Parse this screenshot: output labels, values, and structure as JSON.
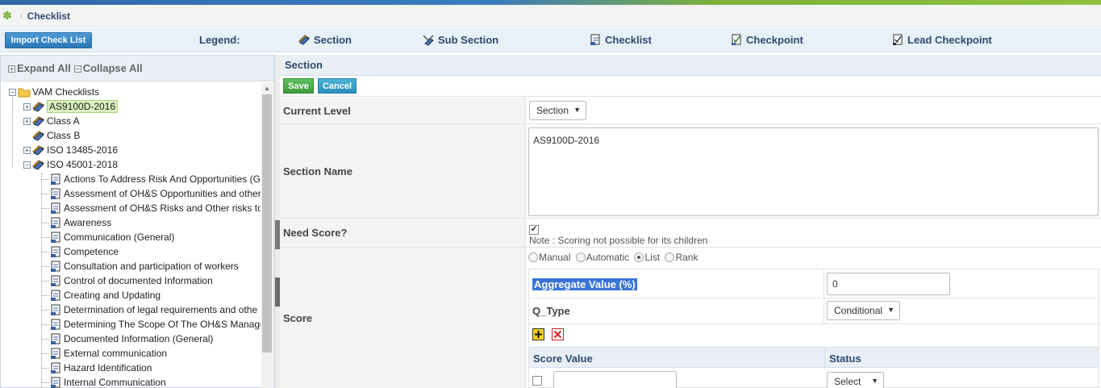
{
  "breadcrumb": {
    "title": "Checklist"
  },
  "toolbar": {
    "import_label": "Import Check List",
    "legend_label": "Legend:",
    "legend": [
      {
        "label": "Section",
        "icon": "section-icon"
      },
      {
        "label": "Sub Section",
        "icon": "sub-section-icon"
      },
      {
        "label": "Checklist",
        "icon": "checklist-icon"
      },
      {
        "label": "Checkpoint",
        "icon": "checkpoint-icon"
      },
      {
        "label": "Lead Checkpoint",
        "icon": "lead-checkpoint-icon"
      }
    ]
  },
  "tree": {
    "expand_all": "Expand All",
    "collapse_all": "Collapse All",
    "root": "VAM Checklists",
    "nodes": [
      "AS9100D-2016",
      "Class A",
      "Class B",
      "ISO 13485-2016",
      "ISO 45001-2018"
    ],
    "children": [
      "Actions To Address Risk And Opportunities (G",
      "Assessment of OH&S Opportunities and other",
      "Assessment of OH&S Risks and Other risks to",
      "Awareness",
      "Communication (General)",
      "Competence",
      "Consultation and participation of workers",
      "Control of documented Information",
      "Creating and Updating",
      "Determination of legal requirements and othe",
      "Determining The Scope Of The OH&S Manage",
      "Documented Information (General)",
      "External communication",
      "Hazard Identification",
      "Internal Communication"
    ]
  },
  "form": {
    "panel_title": "Section",
    "save_label": "Save",
    "cancel_label": "Cancel",
    "current_level_label": "Current Level",
    "current_level_value": "Section",
    "section_name_label": "Section Name",
    "section_name_value": "AS9100D-2016",
    "need_score_label": "Need Score?",
    "need_score_note": "Note : Scoring not possible for its children",
    "score_label": "Score",
    "score_modes": [
      "Manual",
      "Automatic",
      "List",
      "Rank"
    ],
    "aggregate_label": "Aggregate Value (%)",
    "aggregate_value": "0",
    "qtype_label": "Q_Type",
    "qtype_value": "Conditional",
    "score_value_header": "Score Value",
    "status_header": "Status",
    "status_select": "Select"
  },
  "colors": {
    "accent": "#2c4a6e",
    "save": "#3d9a3d",
    "cancel": "#2a90bb",
    "selected_node": "#d9f0c0"
  }
}
